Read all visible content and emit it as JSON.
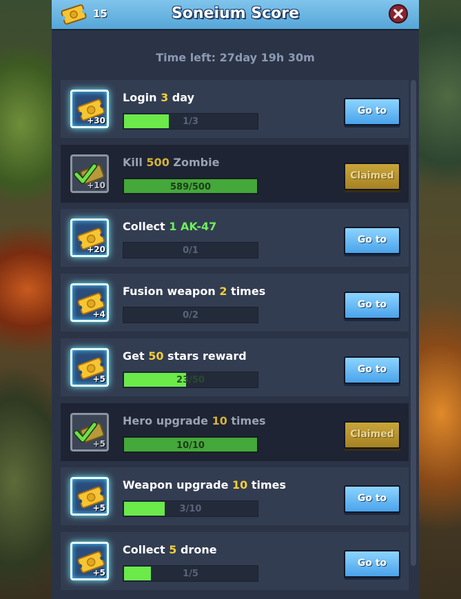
{
  "header": {
    "ticket_count": "15",
    "title": "Soneium Score",
    "icons": {
      "ticket": "ticket-icon",
      "close": "close-icon"
    }
  },
  "time_left": "Time left: 27day 19h 30m",
  "colors": {
    "header_blue": "#6bb6e6",
    "panel": "#2b3446",
    "highlight_yellow": "#f3cf3a",
    "highlight_green": "#6ef05a",
    "progress_green": "#6bea4a",
    "goto_button": "#4aa3ea",
    "claimed_button": "#b8952e"
  },
  "tasks": [
    {
      "title_pre": "Login ",
      "title_hl": "3",
      "title_post": " day",
      "hl_color": "yellow",
      "reward": "+30",
      "progress_text": "1/3",
      "progress": 0.333,
      "status": "go",
      "button_label": "Go to"
    },
    {
      "title_pre": "Kill ",
      "title_hl": "500",
      "title_post": " Zombie",
      "hl_color": "yellow",
      "reward": "+10",
      "progress_text": "589/500",
      "progress": 1.0,
      "status": "claimed",
      "button_label": "Claimed"
    },
    {
      "title_pre": "Collect ",
      "title_hl": "1 AK-47",
      "title_post": "",
      "hl_color": "green",
      "reward": "+20",
      "progress_text": "0/1",
      "progress": 0.0,
      "status": "go",
      "button_label": "Go to"
    },
    {
      "title_pre": "Fusion weapon ",
      "title_hl": "2",
      "title_post": " times",
      "hl_color": "yellow",
      "reward": "+4",
      "progress_text": "0/2",
      "progress": 0.0,
      "status": "go",
      "button_label": "Go to"
    },
    {
      "title_pre": "Get ",
      "title_hl": "50",
      "title_post": " stars reward",
      "hl_color": "yellow",
      "reward": "+5",
      "progress_text": "23/50",
      "progress": 0.46,
      "status": "go",
      "button_label": "Go to"
    },
    {
      "title_pre": "Hero upgrade ",
      "title_hl": "10",
      "title_post": " times",
      "hl_color": "yellow",
      "reward": "+5",
      "progress_text": "10/10",
      "progress": 1.0,
      "status": "claimed",
      "button_label": "Claimed"
    },
    {
      "title_pre": "Weapon upgrade ",
      "title_hl": "10",
      "title_post": " times",
      "hl_color": "yellow",
      "reward": "+5",
      "progress_text": "3/10",
      "progress": 0.3,
      "status": "go",
      "button_label": "Go to"
    },
    {
      "title_pre": "Collect ",
      "title_hl": "5",
      "title_post": " drone",
      "hl_color": "yellow",
      "reward": "+5",
      "progress_text": "1/5",
      "progress": 0.2,
      "status": "go",
      "button_label": "Go to"
    }
  ]
}
